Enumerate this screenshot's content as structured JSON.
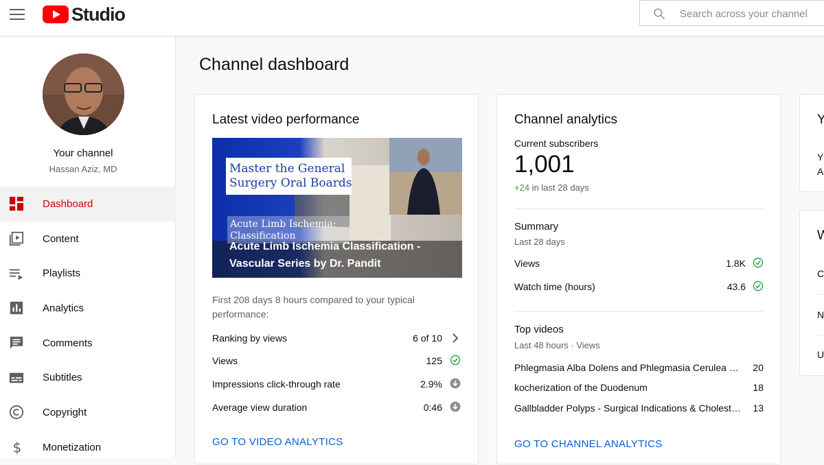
{
  "header": {
    "logo_text": "Studio",
    "search_placeholder": "Search across your channel"
  },
  "sidebar": {
    "channel_label": "Your channel",
    "channel_name": "Hassan Aziz, MD",
    "items": [
      {
        "label": "Dashboard",
        "icon": "dashboard-icon",
        "active": true
      },
      {
        "label": "Content",
        "icon": "content-icon"
      },
      {
        "label": "Playlists",
        "icon": "playlists-icon"
      },
      {
        "label": "Analytics",
        "icon": "analytics-icon"
      },
      {
        "label": "Comments",
        "icon": "comments-icon"
      },
      {
        "label": "Subtitles",
        "icon": "subtitles-icon"
      },
      {
        "label": "Copyright",
        "icon": "copyright-icon"
      },
      {
        "label": "Monetization",
        "icon": "monetization-icon"
      }
    ]
  },
  "main": {
    "title": "Channel dashboard"
  },
  "latest_video": {
    "title": "Latest video performance",
    "thumbnail": {
      "headline_line1": "Master the General",
      "headline_line2": "Surgery Oral Boards",
      "sub_line1": "Acute Limb Ischemia:",
      "sub_line2": "Classification",
      "video_title_line1": "Acute Limb Ischemia Classification -",
      "video_title_line2": "Vascular Series by Dr. Pandit"
    },
    "compare_text": "First 208 days 8 hours compared to your typical performance:",
    "metrics": [
      {
        "label": "Ranking by views",
        "value": "6 of 10",
        "icon": "chevron-right-icon"
      },
      {
        "label": "Views",
        "value": "125",
        "icon": "check-circle-icon"
      },
      {
        "label": "Impressions click-through rate",
        "value": "2.9%",
        "icon": "arrow-down-circle-icon"
      },
      {
        "label": "Average view duration",
        "value": "0:46",
        "icon": "arrow-down-circle-icon"
      }
    ],
    "link": "GO TO VIDEO ANALYTICS"
  },
  "channel_analytics": {
    "title": "Channel analytics",
    "subs_label": "Current subscribers",
    "subs_value": "1,001",
    "subs_change": "+24",
    "subs_change_suffix": " in last 28 days",
    "summary_title": "Summary",
    "summary_period": "Last 28 days",
    "summary": [
      {
        "label": "Views",
        "value": "1.8K"
      },
      {
        "label": "Watch time (hours)",
        "value": "43.6"
      }
    ],
    "top_title": "Top videos",
    "top_period": "Last 48 hours · Views",
    "top_videos": [
      {
        "title": "Phlegmasia Alba Dolens and Phlegmasia Cerulea Dolens",
        "views": "20"
      },
      {
        "title": "kocherization of the Duodenum",
        "views": "18"
      },
      {
        "title": "Gallbladder Polyps - Surgical Indications & Cholesterolosis",
        "views": "13"
      }
    ],
    "link": "GO TO CHANNEL ANALYTICS"
  },
  "right_cards": {
    "card1_title": "Y",
    "card1_line1": "Y",
    "card1_line2": "A",
    "card2_title": "W",
    "card2_line1": "C",
    "card2_line2": "N",
    "card2_line3": "U"
  },
  "colors": {
    "accent_red": "#cc0000",
    "link_blue": "#065fd4",
    "success_green": "#2ba640"
  }
}
